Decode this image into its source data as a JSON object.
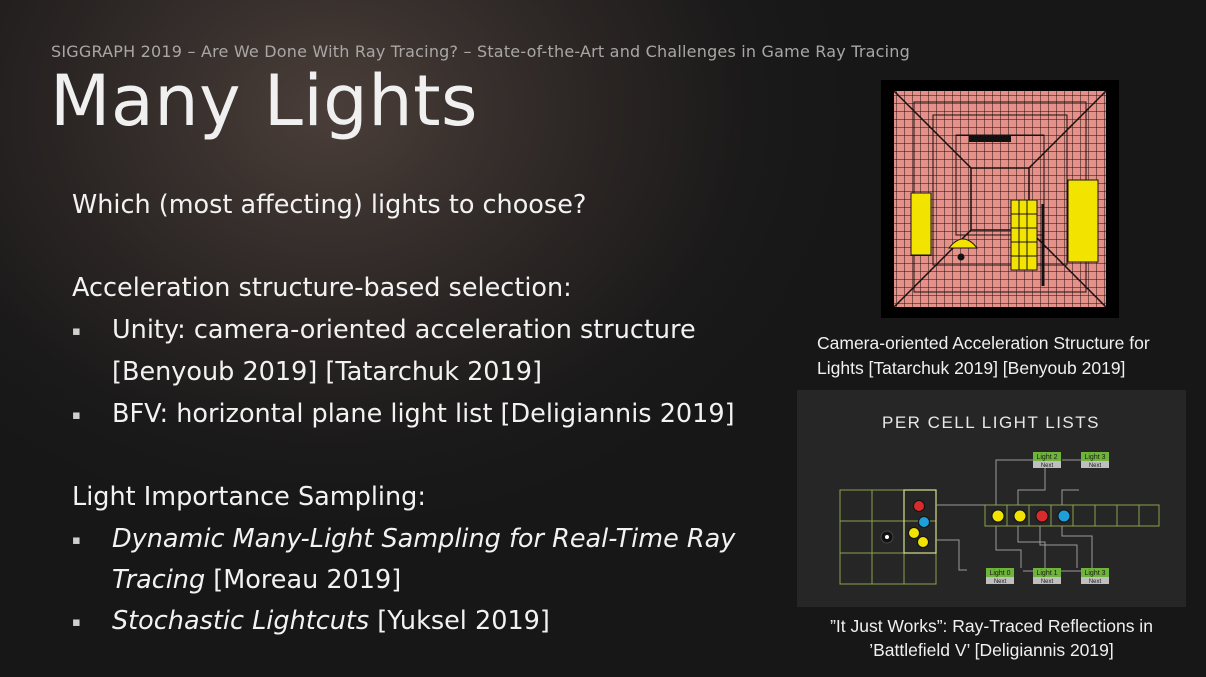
{
  "header": "SIGGRAPH 2019 – Are We Done With Ray Tracing? – State-of-the-Art and Challenges in Game Ray Tracing",
  "title": "Many Lights",
  "question": "Which (most affecting) lights to choose?",
  "accel_heading": "Acceleration structure-based selection:",
  "accel_items": [
    {
      "line1": "Unity: camera-oriented acceleration structure",
      "line2": "[Benyoub 2019] [Tatarchuk 2019]"
    },
    {
      "line1": "BFV: horizontal plane light list [Deligiannis 2019]"
    }
  ],
  "lis_heading": "Light Importance Sampling:",
  "lis_items": [
    {
      "italic1": "Dynamic Many-Light Sampling for Real-Time Ray",
      "italic2": "Tracing",
      "ref": " [Moreau 2019]"
    },
    {
      "italic1": "Stochastic Lightcuts",
      "ref": " [Yuksel 2019]"
    }
  ],
  "bullet_glyph": "▪",
  "figure1": {
    "caption_line1": "Camera-oriented Acceleration Structure for",
    "caption_line2": "Lights [Tatarchuk 2019] [Benyoub 2019]"
  },
  "figure2": {
    "title": "PER CELL LIGHT LISTS",
    "node_labels": {
      "light0": "Light 0",
      "light1": "Light 1",
      "light2": "Light 2",
      "light3_top": "Light 3",
      "light3_bottom": "Light 3",
      "next": "Next"
    },
    "caption_line1": "”It Just Works”: Ray-Traced Reflections in",
    "caption_line2": "’Battlefield V’ [Deligiannis 2019]"
  },
  "colors": {
    "background": "#1b1a1a",
    "wall": "#e59088",
    "light_yellow": "#f2e400",
    "grid_green": "#8aa34a",
    "node_green": "#6fb43a",
    "red_light": "#d82b2b",
    "blue_light": "#1e9fd8"
  }
}
